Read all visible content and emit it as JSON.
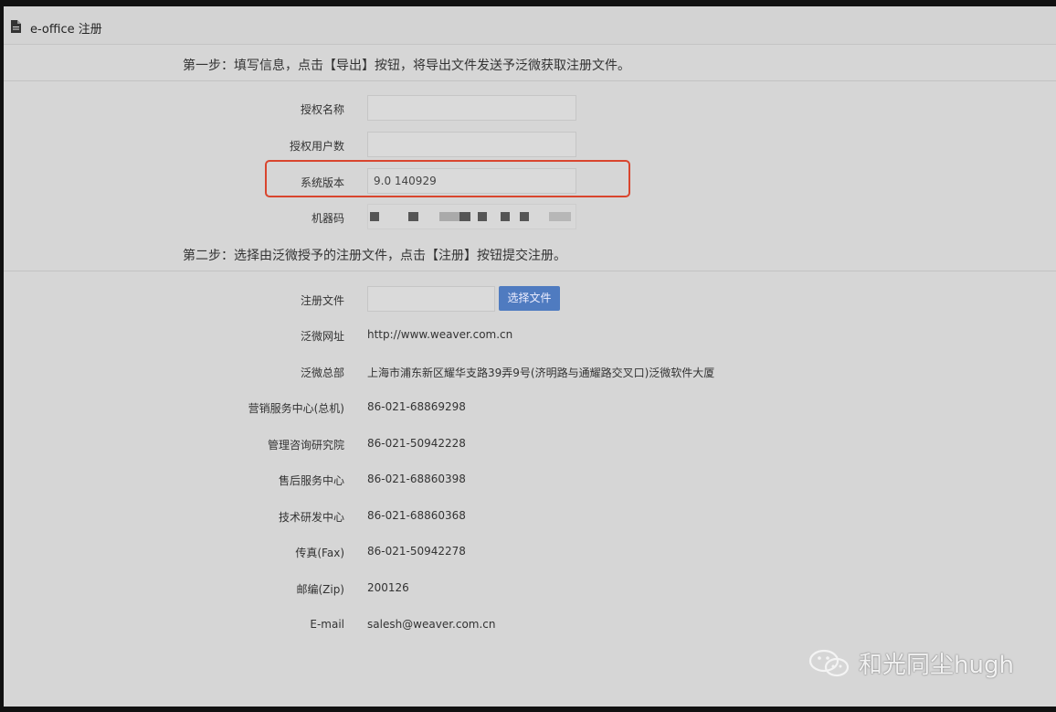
{
  "window": {
    "title": "e-office 注册"
  },
  "step1": {
    "text": "第一步：填写信息，点击【导出】按钮，将导出文件发送予泛微获取注册文件。",
    "fields": [
      {
        "label": "授权名称",
        "value": ""
      },
      {
        "label": "授权用户数",
        "value": ""
      },
      {
        "label": "系统版本",
        "value": "9.0 140929"
      },
      {
        "label": "机器码",
        "value": ""
      }
    ]
  },
  "step2": {
    "text": "第二步：选择由泛微授予的注册文件，点击【注册】按钮提交注册。",
    "file_label": "注册文件",
    "file_value": "",
    "choose_button": "选择文件"
  },
  "info": [
    {
      "label": "泛微网址",
      "value": "http://www.weaver.com.cn"
    },
    {
      "label": "泛微总部",
      "value": "上海市浦东新区耀华支路39弄9号(济明路与通耀路交叉口)泛微软件大厦"
    },
    {
      "label": "营销服务中心(总机)",
      "value": "86-021-68869298"
    },
    {
      "label": "管理咨询研究院",
      "value": "86-021-50942228"
    },
    {
      "label": "售后服务中心",
      "value": "86-021-68860398"
    },
    {
      "label": "技术研发中心",
      "value": "86-021-68860368"
    },
    {
      "label": "传真(Fax)",
      "value": "86-021-50942278"
    },
    {
      "label": "邮编(Zip)",
      "value": "200126"
    },
    {
      "label": "E-mail",
      "value": "salesh@weaver.com.cn"
    }
  ],
  "watermark": {
    "text": "和光同尘hugh",
    "icon": "wechat-icon"
  },
  "colors": {
    "highlight": "#d9452e",
    "button": "#4f7bc0"
  }
}
